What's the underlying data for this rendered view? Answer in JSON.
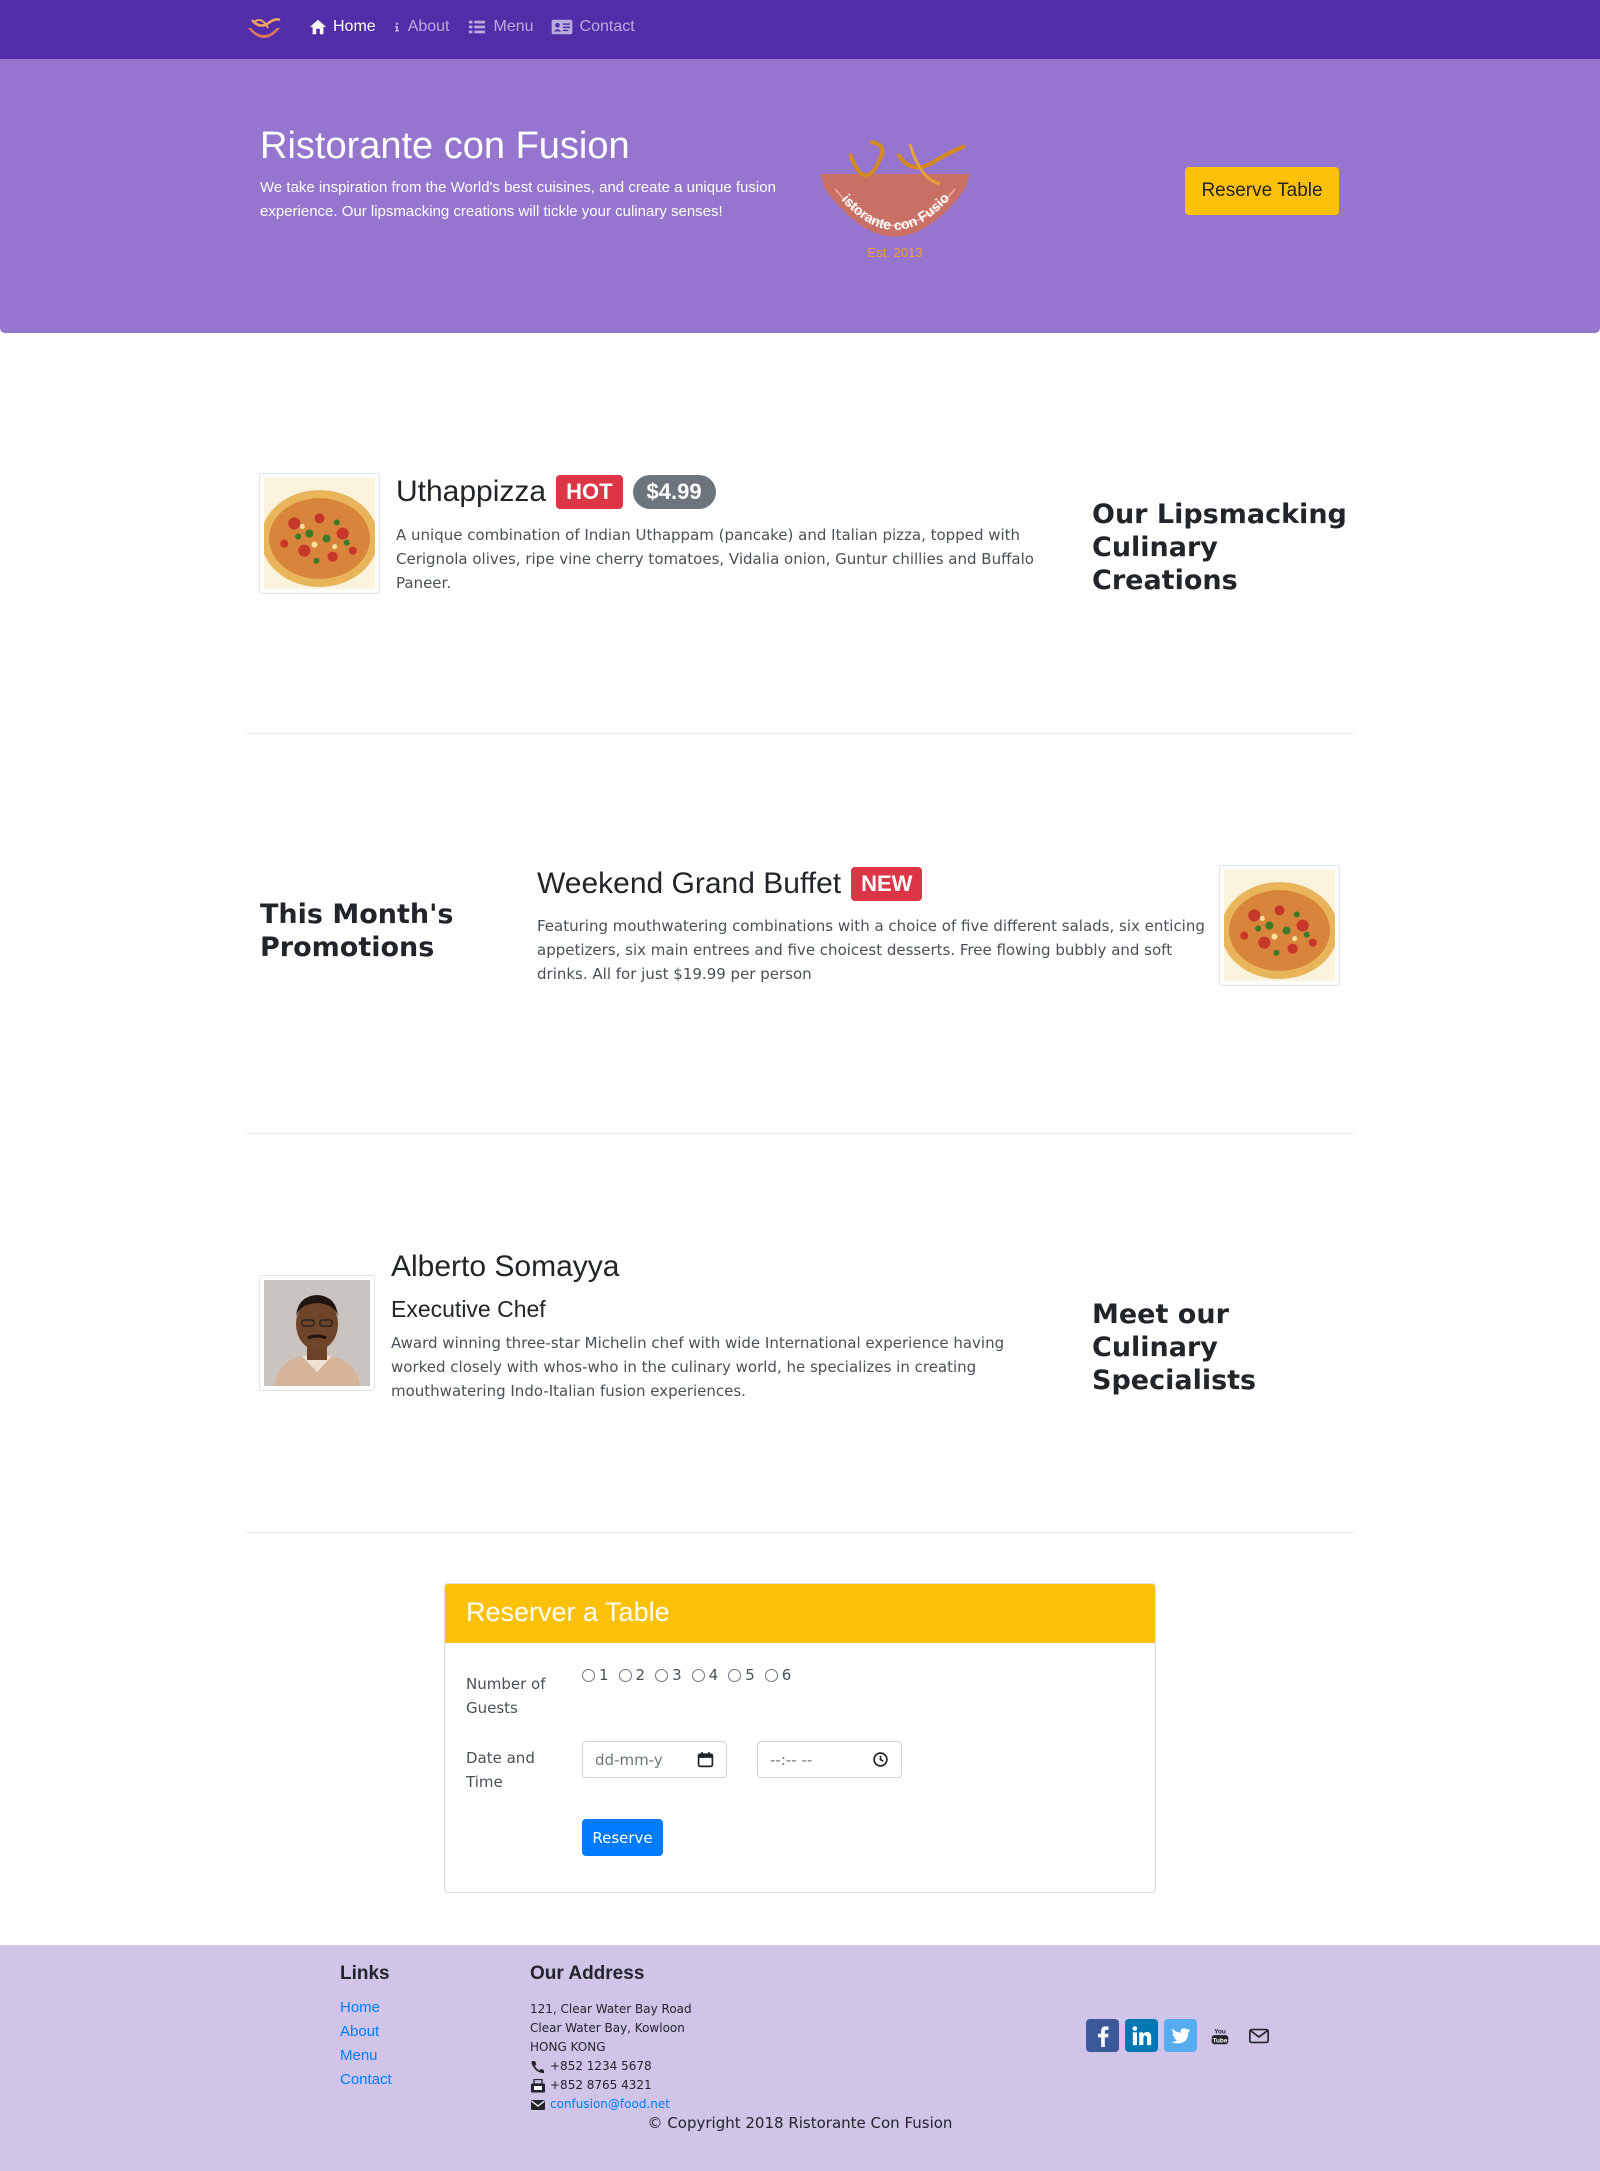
{
  "navbar": {
    "items": [
      {
        "label": "Home",
        "icon": "home-icon",
        "active": true
      },
      {
        "label": "About",
        "icon": "info-icon",
        "active": false
      },
      {
        "label": "Menu",
        "icon": "list-icon",
        "active": false
      },
      {
        "label": "Contact",
        "icon": "address-card-icon",
        "active": false
      }
    ]
  },
  "jumbotron": {
    "title": "Ristorante con Fusion",
    "text": "We take inspiration from the World's best cuisines, and create a unique fusion experience. Our lipsmacking creations will tickle your culinary senses!",
    "logo_text": "Ristorante con Fusion",
    "logo_est": "Est. 2013",
    "reserve_label": "Reserve Table"
  },
  "dish": {
    "title": "Uthappizza",
    "badge_hot": "HOT",
    "price": "$4.99",
    "text": "A unique combination of Indian Uthappam (pancake) and Italian pizza, topped with Cerignola olives, ripe vine cherry tomatoes, Vidalia onion, Guntur chillies and Buffalo Paneer.",
    "side_heading": "Our Lipsmacking Culinary Creations"
  },
  "promotion": {
    "side_heading": "This Month's Promotions",
    "title": "Weekend Grand Buffet",
    "badge_new": "NEW",
    "text": "Featuring mouthwatering combinations with a choice of five different salads, six enticing appetizers, six main entrees and five choicest desserts. Free flowing bubbly and soft drinks. All for just $19.99 per person"
  },
  "leader": {
    "name": "Alberto Somayya",
    "designation": "Executive Chef",
    "text": "Award winning three-star Michelin chef with wide International experience having worked closely with whos-who in the culinary world, he specializes in creating mouthwatering Indo-Italian fusion experiences.",
    "side_heading": "Meet our Culinary Specialists"
  },
  "reservation": {
    "title": "Reserver a Table",
    "guests_label": "Number of Guests",
    "guest_options": [
      "1",
      "2",
      "3",
      "4",
      "5",
      "6"
    ],
    "datetime_label": "Date and Time",
    "date_placeholder": "dd-mm-y",
    "time_placeholder": "--:-- --",
    "submit_label": "Reserve"
  },
  "footer": {
    "links_heading": "Links",
    "links": [
      "Home",
      "About",
      "Menu",
      "Contact"
    ],
    "address_heading": "Our Address",
    "address_lines": [
      "121, Clear Water Bay Road",
      "Clear Water Bay, Kowloon",
      "HONG KONG"
    ],
    "phone": "+852 1234 5678",
    "fax": "+852 8765 4321",
    "email": "confusion@food.net",
    "social": [
      "facebook-icon",
      "linkedin-icon",
      "twitter-icon",
      "youtube-icon",
      "envelope-icon"
    ],
    "copyright": "© Copyright 2018 Ristorante Con Fusion"
  },
  "colors": {
    "navbar": "#512DA8",
    "jumbotron": "#9575CD",
    "footer": "#D1C4E9",
    "accent": "#FFC107",
    "primary": "#007bff",
    "danger": "#dc3545"
  }
}
